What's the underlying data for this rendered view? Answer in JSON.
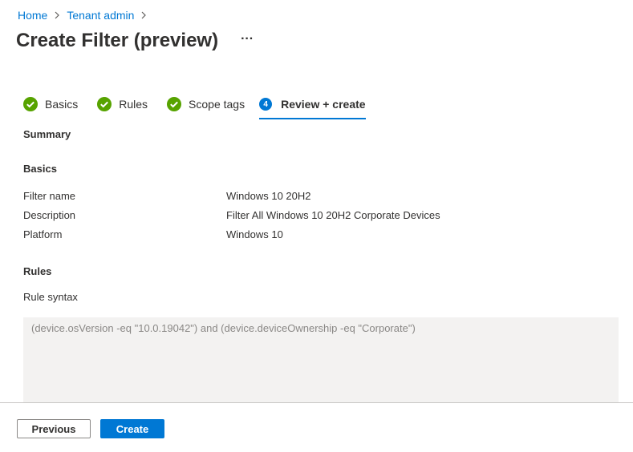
{
  "breadcrumb": {
    "home": "Home",
    "tenant_admin": "Tenant admin"
  },
  "page": {
    "title": "Create Filter (preview)",
    "more": "···"
  },
  "tabs": [
    {
      "label": "Basics",
      "state": "complete"
    },
    {
      "label": "Rules",
      "state": "complete"
    },
    {
      "label": "Scope tags",
      "state": "complete"
    },
    {
      "label": "Review + create",
      "state": "active",
      "step": "4"
    }
  ],
  "summary": {
    "heading": "Summary",
    "basics_heading": "Basics",
    "fields": [
      {
        "label": "Filter name",
        "value": "Windows 10 20H2"
      },
      {
        "label": "Description",
        "value": "Filter All Windows 10 20H2 Corporate Devices"
      },
      {
        "label": "Platform",
        "value": "Windows 10"
      }
    ],
    "rules_heading": "Rules",
    "rule_syntax_label": "Rule syntax",
    "rule_syntax": "(device.osVersion -eq \"10.0.19042\") and (device.deviceOwnership -eq \"Corporate\")"
  },
  "footer": {
    "previous_label": "Previous",
    "create_label": "Create"
  },
  "colors": {
    "accent": "#0078d4",
    "success": "#57a300",
    "rule_box_bg": "#f3f2f1"
  },
  "icons": {
    "complete": "checkmark-circle-icon",
    "separator": "chevron-right-icon",
    "more": "more-ellipsis-icon"
  }
}
